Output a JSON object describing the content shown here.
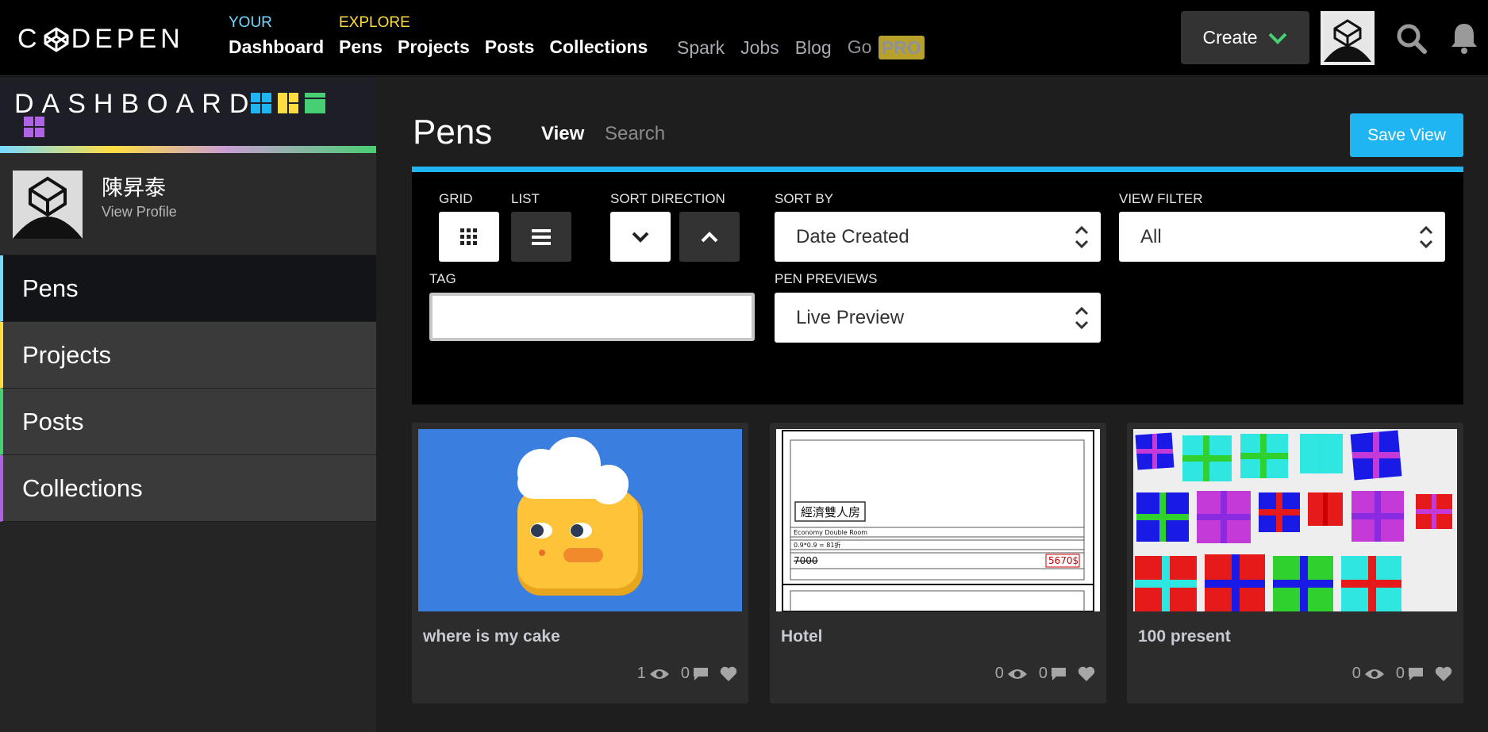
{
  "topbar": {
    "logo_text": "CODEPEN",
    "your_label": "YOUR",
    "your_links": [
      "Dashboard"
    ],
    "explore_label": "EXPLORE",
    "explore_links": [
      "Pens",
      "Projects",
      "Posts",
      "Collections"
    ],
    "secondary_links": [
      "Spark",
      "Jobs",
      "Blog",
      "Go"
    ],
    "pro_badge": "PRO",
    "create_label": "Create",
    "colors": {
      "your": "#76daff",
      "explore": "#ffdd40",
      "create_chevron": "#47cf73"
    }
  },
  "sidebar": {
    "title": "DASHBOARD",
    "profile_name": "陳昇泰",
    "profile_link": "View Profile",
    "items": [
      {
        "label": "Pens",
        "color": "#76daff"
      },
      {
        "label": "Projects",
        "color": "#ffdd40"
      },
      {
        "label": "Posts",
        "color": "#47cf73"
      },
      {
        "label": "Collections",
        "color": "#ae63e4"
      }
    ]
  },
  "main": {
    "title": "Pens",
    "tabs": [
      {
        "label": "View",
        "active": true
      },
      {
        "label": "Search",
        "active": false
      }
    ],
    "save_view_label": "Save View",
    "filters": {
      "grid_label": "GRID",
      "list_label": "LIST",
      "sort_direction_label": "SORT DIRECTION",
      "sort_by_label": "SORT BY",
      "sort_by_value": "Date Created",
      "view_filter_label": "VIEW FILTER",
      "view_filter_value": "All",
      "tag_label": "TAG",
      "tag_value": "",
      "pen_previews_label": "PEN PREVIEWS",
      "pen_previews_value": "Live Preview"
    },
    "cards": [
      {
        "title": "where is my cake",
        "views": "1",
        "comments": "0",
        "preview_bg": "#3a7fe0"
      },
      {
        "title": "Hotel",
        "views": "0",
        "comments": "0",
        "preview_bg": "#ffffff",
        "preview_text": {
          "room_cn": "經濟雙人房",
          "room_en": "Economy Double Room",
          "calc": "0.9*0.9 = 81折",
          "price_old": "7000",
          "price_new": "5670$"
        }
      },
      {
        "title": "100 present",
        "views": "0",
        "comments": "0",
        "preview_bg": "#eeeeee"
      }
    ]
  }
}
